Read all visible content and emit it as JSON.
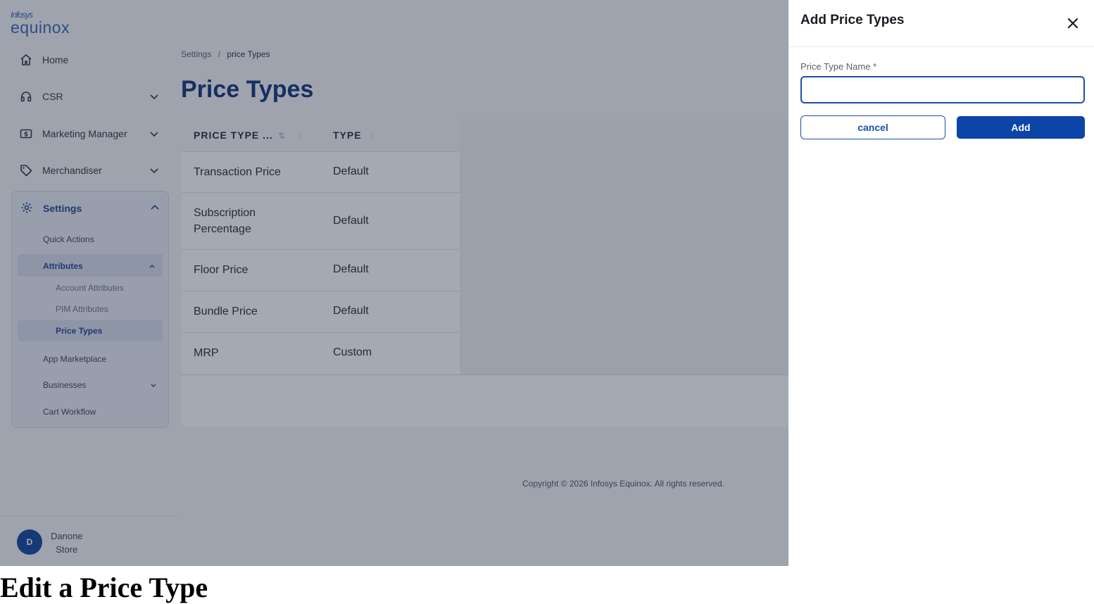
{
  "brand": {
    "top": "Infosys",
    "name": "equinox"
  },
  "sidebar": {
    "items": [
      {
        "label": "Home",
        "icon": "home-icon"
      },
      {
        "label": "CSR",
        "icon": "headset-icon"
      },
      {
        "label": "Marketing Manager",
        "icon": "dollar-icon"
      },
      {
        "label": "Merchandiser",
        "icon": "tag-icon"
      }
    ],
    "settings": {
      "label": "Settings",
      "children": {
        "quick_actions": "Quick Actions",
        "attributes": "Attributes",
        "account_attributes": "Account Attributes",
        "pim_attributes": "PIM Attributes",
        "price_types": "Price Types",
        "app_marketplace": "App Marketplace",
        "businesses": "Businesses",
        "cart_workflow": "Cart Workflow"
      }
    },
    "user": {
      "initial": "D",
      "name_line1": "Danone",
      "name_line2": "Store"
    }
  },
  "breadcrumb": {
    "parent": "Settings",
    "separator": "/",
    "current": "price Types"
  },
  "page_title": "Price Types",
  "table": {
    "headers": [
      "PRICE TYPE ...",
      "TYPE"
    ],
    "rows": [
      {
        "name": "Transaction Price",
        "type": "Default"
      },
      {
        "name_line1": "Subscription",
        "name_line2": "Percentage",
        "type": "Default"
      },
      {
        "name": "Floor Price",
        "type": "Default"
      },
      {
        "name": "Bundle Price",
        "type": "Default"
      },
      {
        "name": "MRP",
        "type": "Custom"
      }
    ]
  },
  "footer": {
    "copyright": "Copyright © 2026 Infosys Equinox. All rights reserved."
  },
  "drawer": {
    "title": "Add Price Types",
    "field_label": "Price Type Name *",
    "field_value": "",
    "cancel_label": "cancel",
    "add_label": "Add"
  },
  "under_text": "Edit a Price Type",
  "colors": {
    "primary": "#0c44a8",
    "title": "#0a2e78",
    "active_bg": "#d6ddee"
  }
}
